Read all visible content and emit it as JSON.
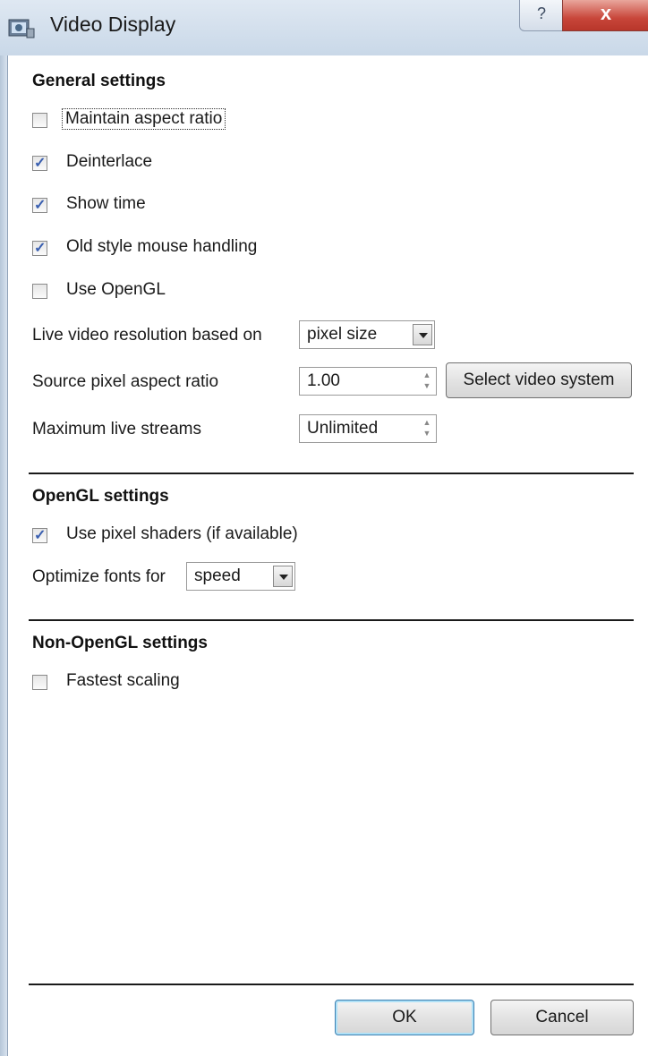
{
  "window": {
    "title": "Video Display",
    "help_glyph": "?",
    "close_glyph": "x"
  },
  "general": {
    "heading": "General settings",
    "checkboxes": [
      {
        "label": "Maintain aspect ratio",
        "checked": false
      },
      {
        "label": "Deinterlace",
        "checked": true
      },
      {
        "label": "Show time",
        "checked": true
      },
      {
        "label": "Old style mouse handling",
        "checked": true
      },
      {
        "label": "Use OpenGL",
        "checked": false
      }
    ],
    "resolution_label": "Live video resolution based on",
    "resolution_value": "pixel size",
    "aspect_label": "Source pixel aspect ratio",
    "aspect_value": "1.00",
    "select_video_system": "Select video system",
    "max_streams_label": "Maximum live streams",
    "max_streams_value": "Unlimited"
  },
  "opengl": {
    "heading": "OpenGL settings",
    "pixel_shaders": {
      "label": "Use pixel shaders (if available)",
      "checked": true
    },
    "optimize_label": "Optimize fonts for",
    "optimize_value": "speed"
  },
  "nonopengl": {
    "heading": "Non-OpenGL settings",
    "fastest_scaling": {
      "label": "Fastest scaling",
      "checked": false
    }
  },
  "buttons": {
    "ok": "OK",
    "cancel": "Cancel"
  },
  "colors": {
    "accent_check": "#3a5fb0",
    "close_red": "#c8463a",
    "titlebar": "#dfe8f2"
  },
  "icons": [
    "app-icon",
    "help-icon",
    "close-icon",
    "dropdown-arrow-icon",
    "spinner-arrows-icon"
  ]
}
